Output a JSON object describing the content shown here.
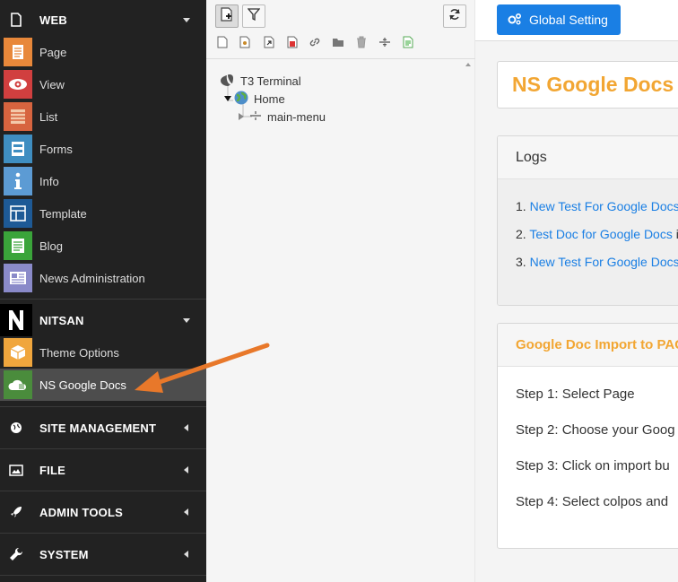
{
  "menu": {
    "web_group": "WEB",
    "web_items": [
      {
        "label": "Page",
        "icon": "page-icon",
        "color": "#e8883a"
      },
      {
        "label": "View",
        "icon": "eye-icon",
        "color": "#d13f3f"
      },
      {
        "label": "List",
        "icon": "list-icon",
        "color": "#d7643f"
      },
      {
        "label": "Forms",
        "icon": "forms-icon",
        "color": "#3f8ec1"
      },
      {
        "label": "Info",
        "icon": "info-icon",
        "color": "#5c9bd4"
      },
      {
        "label": "Template",
        "icon": "template-icon",
        "color": "#1e5a96"
      },
      {
        "label": "Blog",
        "icon": "blog-icon",
        "color": "#3aa43a"
      },
      {
        "label": "News Administration",
        "icon": "news-icon",
        "color": "#8a8ac9"
      }
    ],
    "nitsan_group": "NITSAN",
    "nitsan_items": [
      {
        "label": "Theme Options",
        "icon": "box-icon",
        "color": "#f0a63d"
      },
      {
        "label": "NS Google Docs",
        "icon": "google-docs-icon",
        "color": "#4a8c3c"
      }
    ],
    "groups": [
      {
        "label": "SITE MANAGEMENT",
        "icon": "globe-icon"
      },
      {
        "label": "FILE",
        "icon": "image-icon"
      },
      {
        "label": "ADMIN TOOLS",
        "icon": "rocket-icon"
      },
      {
        "label": "SYSTEM",
        "icon": "wrench-icon"
      }
    ]
  },
  "tree": {
    "root": "T3 Terminal",
    "home": "Home",
    "child": "main-menu"
  },
  "content": {
    "global_setting": "Global Setting",
    "title": "NS Google Docs",
    "logs_header": "Logs",
    "logs": [
      {
        "num": "1.",
        "link": "New Test For Google Docs"
      },
      {
        "num": "2.",
        "link": "Test Doc for Google Docs",
        "suffix": " i"
      },
      {
        "num": "3.",
        "link": "New Test For Google Docs"
      }
    ],
    "import_header": "Google Doc Import to PAG",
    "steps": [
      "Step 1: Select Page",
      "Step 2: Choose your Goog",
      "Step 3: Click on import bu",
      "Step 4: Select colpos and"
    ]
  },
  "colors": {
    "menu_bg": "#222222",
    "accent_blue": "#1a7fe4",
    "title_orange": "#f2a633",
    "annotation_arrow": "#e8782a"
  }
}
